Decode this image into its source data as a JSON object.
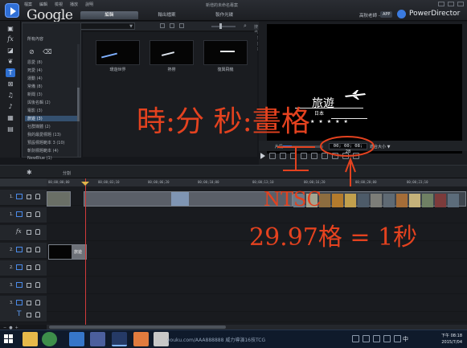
{
  "titlebar": {
    "brand": "Google",
    "menus": [
      "檔案",
      "編輯",
      "檢視",
      "播放",
      "說明"
    ],
    "document_title": "新增的未命名專案",
    "user": "高秋老師 - 設定",
    "app_badge": "APP",
    "product": "PowerDirector"
  },
  "tabs": [
    {
      "label": "編輯",
      "active": true
    },
    {
      "label": "輸出檔案",
      "active": false
    },
    {
      "label": "製作光碟",
      "active": false
    }
  ],
  "tools": [
    "folder-icon",
    "fx-icon",
    "pip-icon",
    "particle-icon",
    "title-icon",
    "transition-icon",
    "audio-icon",
    "voice-icon",
    "chapter-icon",
    "subtitle-icon"
  ],
  "library": {
    "header": "所有內容",
    "dropdown": "範圖",
    "search_placeholder": "搜尋媒體庫",
    "categories": [
      {
        "label": "恩愛 (8)",
        "selected": false
      },
      {
        "label": "死愛 (4)",
        "selected": false
      },
      {
        "label": "運動 (4)",
        "selected": false
      },
      {
        "label": "常備 (8)",
        "selected": false
      },
      {
        "label": "新聞 (3)",
        "selected": false
      },
      {
        "label": "與後名輯 (2)",
        "selected": false
      },
      {
        "label": "電影 (3)",
        "selected": false
      },
      {
        "label": "旅遊 (3)",
        "selected": true
      },
      {
        "label": "社群媒體 (2)",
        "selected": false
      },
      {
        "label": "我的最愛標題 (13)",
        "selected": false
      },
      {
        "label": "預設標題範本 3 (10)",
        "selected": false
      },
      {
        "label": "斬劍標題範本 (4)",
        "selected": false
      },
      {
        "label": "NewBlue (1)",
        "selected": false
      }
    ]
  },
  "templates": [
    {
      "label": "環遊世界"
    },
    {
      "label": "熱帶"
    },
    {
      "label": "復興飛機"
    }
  ],
  "preview": {
    "title": "旅遊",
    "subtitle": "日本",
    "stars": "★★★★★",
    "clip_label": "片段",
    "timecode": "00; 00; 08; 28",
    "fit": "適合大小",
    "progress": 0.22
  },
  "timeline": {
    "split_label": "分割",
    "ruler_ticks": [
      "00;00;00;00",
      "00;00;03;10",
      "00;00;06;20",
      "00;00;10;00",
      "00;00;13;10",
      "00;00;16;20",
      "00;00;20;00",
      "00;00;23;10",
      "00;00;26;20"
    ],
    "tracks": [
      {
        "num": "1.",
        "kind": "video"
      },
      {
        "num": "1.",
        "kind": "audio"
      },
      {
        "num": "",
        "kind": "fx"
      },
      {
        "num": "2.",
        "kind": "video"
      },
      {
        "num": "2.",
        "kind": "audio"
      },
      {
        "num": "3.",
        "kind": "video"
      },
      {
        "num": "3.",
        "kind": "audio"
      },
      {
        "num": "",
        "kind": "title"
      }
    ],
    "title_clip_label": "旅遊"
  },
  "taskbar": {
    "watermark": "youku.com/AAA888888   威力導演16技TCG",
    "time": "下午 08:18",
    "date": "2015/7/04",
    "ime": "中"
  },
  "annotations": {
    "line1": "時:分 秒:畫格",
    "line2": "NTSC",
    "line3": "29.97格 = 1秒"
  }
}
